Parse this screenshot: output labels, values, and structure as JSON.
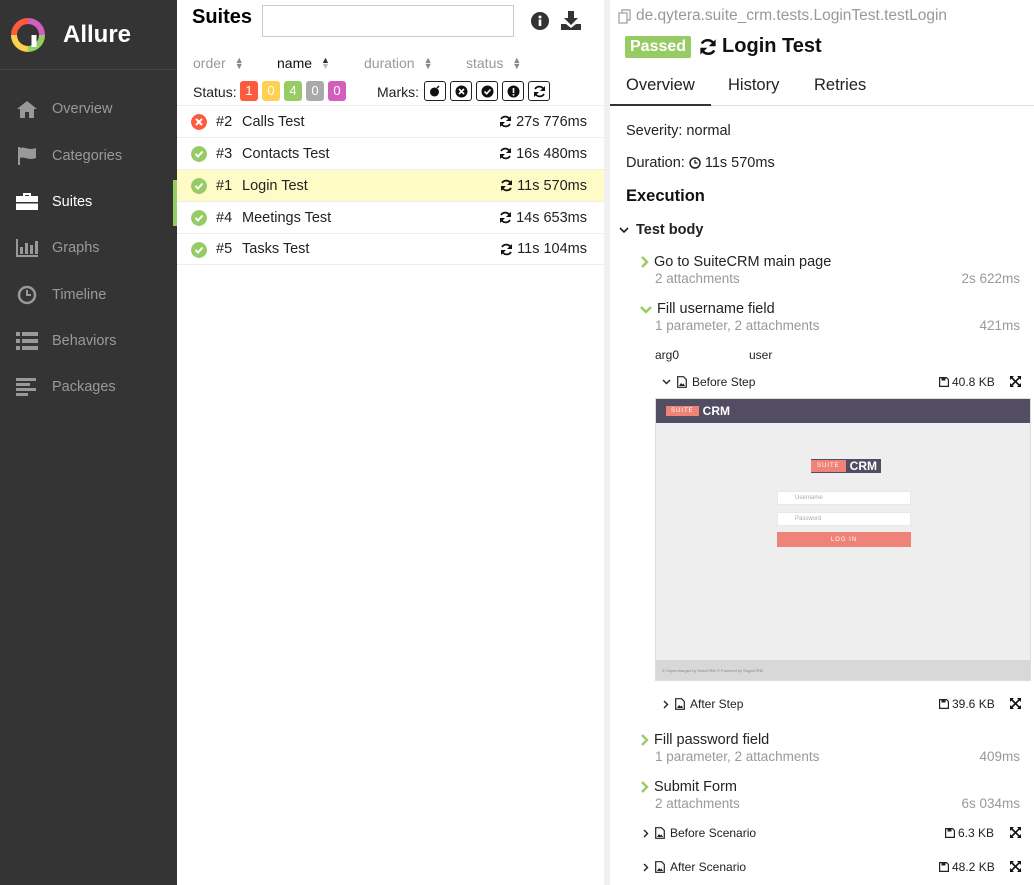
{
  "sidebar": {
    "brand": "Allure",
    "items": [
      {
        "label": "Overview",
        "icon": "home-icon"
      },
      {
        "label": "Categories",
        "icon": "flag-icon"
      },
      {
        "label": "Suites",
        "icon": "briefcase-icon"
      },
      {
        "label": "Graphs",
        "icon": "bar-chart-icon"
      },
      {
        "label": "Timeline",
        "icon": "clock-icon"
      },
      {
        "label": "Behaviors",
        "icon": "list-icon"
      },
      {
        "label": "Packages",
        "icon": "align-left-icon"
      }
    ],
    "active": "Suites"
  },
  "suites": {
    "title": "Suites",
    "search_value": "",
    "sort": [
      {
        "label": "order"
      },
      {
        "label": "name"
      },
      {
        "label": "duration"
      },
      {
        "label": "status"
      }
    ],
    "status_label": "Status:",
    "marks_label": "Marks:",
    "counts": [
      {
        "value": "1",
        "color": "#fd5a3e"
      },
      {
        "value": "0",
        "color": "#ffd050"
      },
      {
        "value": "4",
        "color": "#97cc64"
      },
      {
        "value": "0",
        "color": "#aaaaaa"
      },
      {
        "value": "0",
        "color": "#d35ebe"
      }
    ],
    "rows": [
      {
        "num": "#2",
        "name": "Calls Test",
        "duration": "27s 776ms",
        "status": "failed"
      },
      {
        "num": "#3",
        "name": "Contacts Test",
        "duration": "16s 480ms",
        "status": "passed"
      },
      {
        "num": "#1",
        "name": "Login Test",
        "duration": "11s 570ms",
        "status": "passed"
      },
      {
        "num": "#4",
        "name": "Meetings Test",
        "duration": "14s 653ms",
        "status": "passed"
      },
      {
        "num": "#5",
        "name": "Tasks Test",
        "duration": "11s 104ms",
        "status": "passed"
      }
    ]
  },
  "detail": {
    "path": "de.qytera.suite_crm.tests.LoginTest.testLogin",
    "status": "Passed",
    "title": "Login Test",
    "tabs": [
      "Overview",
      "History",
      "Retries"
    ],
    "severity": "Severity: normal",
    "duration_label": "Duration:",
    "duration": "11s 570ms",
    "execution": "Execution",
    "test_body": "Test body",
    "steps": [
      {
        "name": "Go to SuiteCRM main page",
        "sub": "2 attachments",
        "dur": "2s 622ms"
      },
      {
        "name": "Fill username field",
        "sub": "1 parameter, 2 attachments",
        "dur": "421ms"
      },
      {
        "name": "Fill password field",
        "sub": "1 parameter, 2 attachments",
        "dur": "409ms"
      },
      {
        "name": "Submit Form",
        "sub": "2 attachments",
        "dur": "6s 034ms"
      }
    ],
    "param": {
      "name": "arg0",
      "value": "user"
    },
    "attachments": [
      {
        "name": "Before Step",
        "size": "40.8 KB"
      },
      {
        "name": "After Step",
        "size": "39.6 KB"
      },
      {
        "name": "Before Scenario",
        "size": "6.3 KB"
      },
      {
        "name": "After Scenario",
        "size": "48.2 KB"
      }
    ],
    "screenshot": {
      "suite": "SUITE",
      "crm": "CRM",
      "username": "Username",
      "password": "Password",
      "login": "LOG IN",
      "footer": "© Supercharged by SuiteCRM    © Powered by SugarCRM"
    }
  }
}
